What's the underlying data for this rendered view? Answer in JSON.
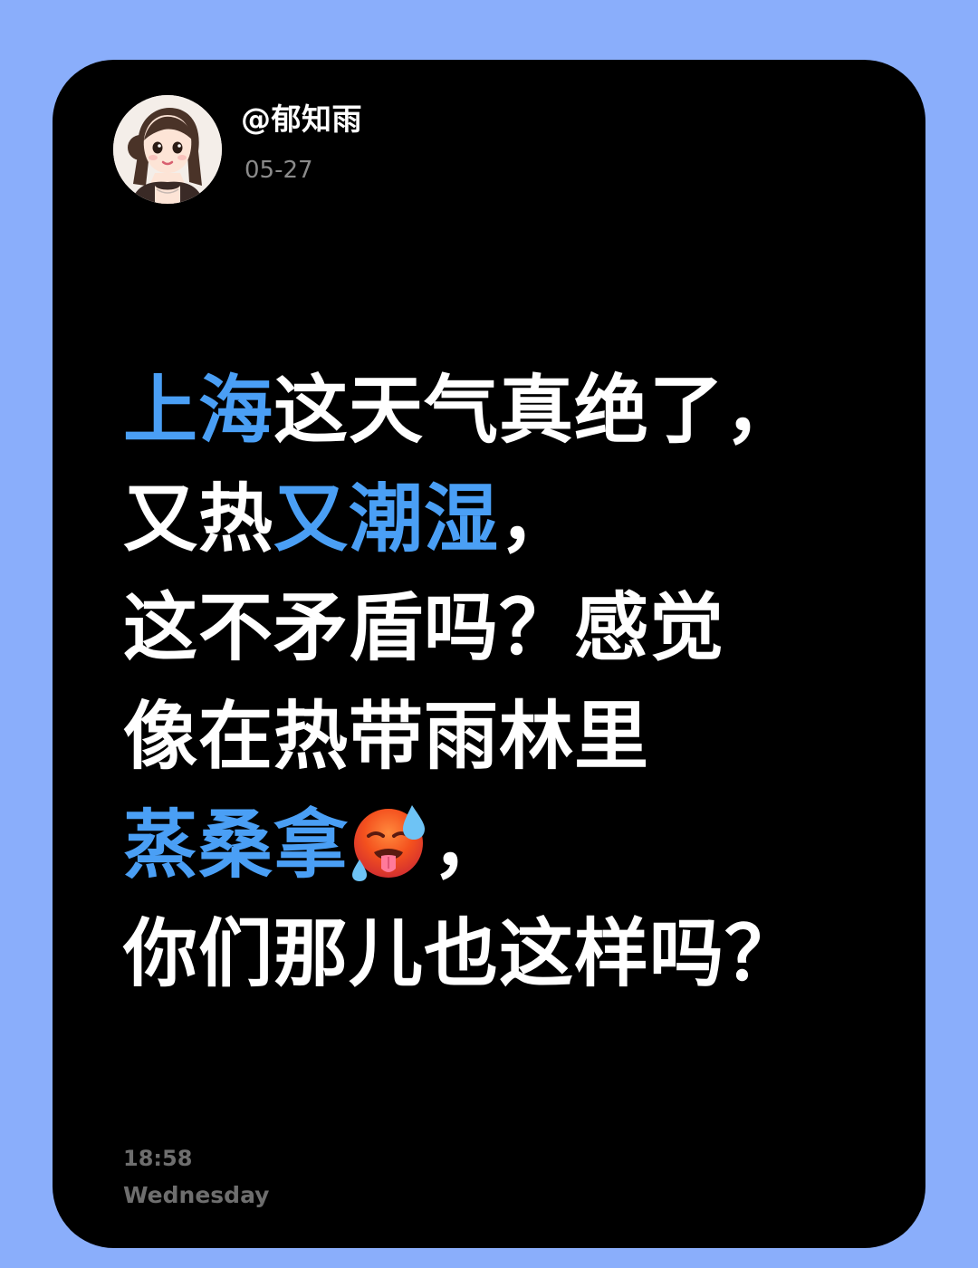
{
  "post": {
    "author": "@郁知雨",
    "date": "05-27",
    "avatar_icon": "girl-portrait-avatar",
    "highlight_color": "#4a9ff5",
    "lines": [
      [
        {
          "text": "上海",
          "hl": true
        },
        {
          "text": "这天气真绝了，",
          "hl": false
        }
      ],
      [
        {
          "text": "又热",
          "hl": false
        },
        {
          "text": "又潮湿",
          "hl": true
        },
        {
          "text": "，",
          "hl": false
        }
      ],
      [
        {
          "text": "这不矛盾吗？感觉",
          "hl": false
        }
      ],
      [
        {
          "text": "像在热带雨林里",
          "hl": false
        }
      ],
      [
        {
          "text": "蒸桑拿",
          "hl": true
        },
        {
          "emoji": "hot-face-sweat-emoji"
        },
        {
          "text": "，",
          "hl": false
        }
      ],
      [
        {
          "text": "你们那儿也这样吗？",
          "hl": false
        }
      ]
    ]
  },
  "footer": {
    "time": "18:58",
    "weekday": "Wednesday"
  },
  "colors": {
    "page_background": "#8aaefb",
    "card_background": "#000000",
    "text": "#ffffff",
    "muted": "#6e6e6e"
  }
}
